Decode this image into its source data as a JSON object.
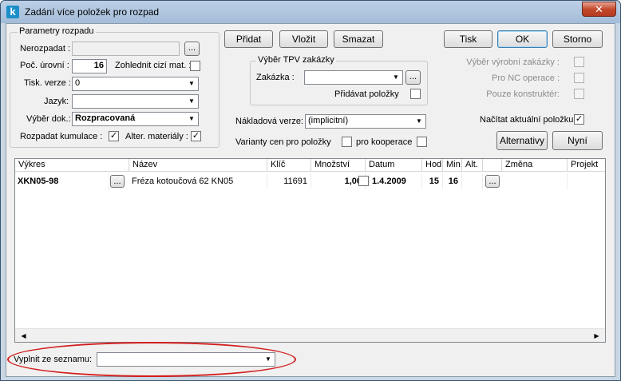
{
  "window": {
    "title": "Zadání více položek pro rozpad",
    "app_icon": "k",
    "close": "✕"
  },
  "params": {
    "legend": "Parametry rozpadu",
    "nerozpadat_label": "Nerozpadat :",
    "nerozpadat_value": "",
    "browse": "...",
    "poc_urovni_label": "Poč. úrovní :",
    "poc_urovni_value": "16",
    "zohlednit_label": "Zohlednit cizí mat. :",
    "tisk_verze_label": "Tisk. verze :",
    "tisk_verze_value": "0",
    "jazyk_label": "Jazyk:",
    "jazyk_value": "",
    "vyber_dok_label": "Výběr dok.:",
    "vyber_dok_value": "Rozpracovaná",
    "kumulace_label": "Rozpadat kumulace :",
    "kumulace_checked": "✓",
    "alter_label": "Alter. materiály :",
    "alter_checked": "✓"
  },
  "buttons": {
    "pridat": "Přidat",
    "vlozit": "Vložit",
    "smazat": "Smazat",
    "tisk": "Tisk",
    "ok": "OK",
    "storno": "Storno",
    "alternativy": "Alternativy",
    "nyni": "Nyní"
  },
  "tpv": {
    "legend": "Výběr TPV zakázky",
    "zakazka_label": "Zakázka :",
    "zakazka_value": "",
    "browse": "...",
    "pridavat_label": "Přidávat položky"
  },
  "right_opts": {
    "vyrobni_label": "Výběr výrobní zakázky :",
    "nc_label": "Pro NC operace :",
    "konstrukter_label": "Pouze konstruktér:",
    "nacitat_label": "Načítat aktuální položku",
    "nacitat_checked": "✓"
  },
  "nakladova": {
    "label": "Nákladová verze:",
    "value": "(implicitní)"
  },
  "varianty": {
    "label": "Varianty cen pro položky",
    "kooperace_label": "pro kooperace"
  },
  "grid": {
    "columns": [
      "Výkres",
      "Název",
      "Klíč",
      "Množství",
      "Datum",
      "Hod.",
      "Min.",
      "Alt.",
      "Změna",
      "Projekt"
    ],
    "rows": [
      {
        "vykres": "XKN05-98",
        "browse": "...",
        "nazev": "Fréza kotoučová 62 KN05",
        "klic": "11691",
        "mnozstvi": "1,00",
        "datum": "1.4.2009",
        "hod": "15",
        "min": "16",
        "alt_browse": "..."
      }
    ],
    "scroll_left": "◀",
    "scroll_right": "▶"
  },
  "vyplnit": {
    "label": "Vyplnit ze seznamu:",
    "value": ""
  },
  "colors": {
    "highlight_ellipse": "#d31f1f",
    "title_bar": "#a3bcd8",
    "close_button": "#c44a2e"
  }
}
